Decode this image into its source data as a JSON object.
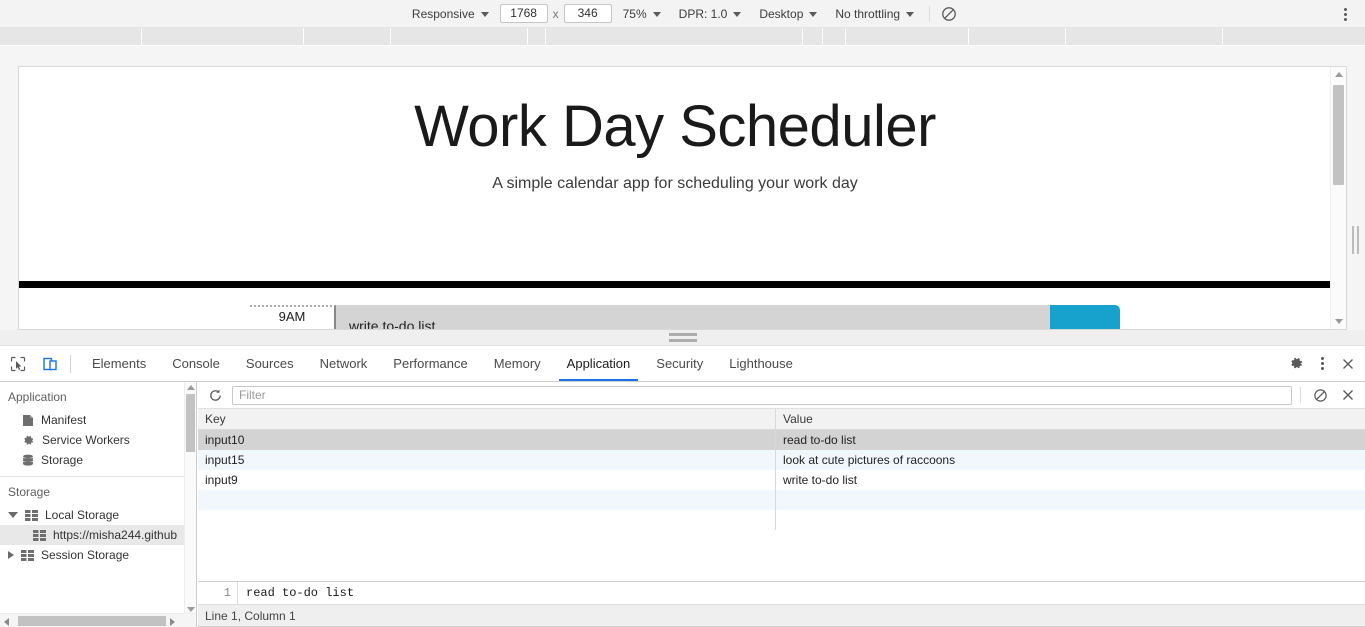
{
  "device_toolbar": {
    "device_select": "Responsive",
    "width": "1768",
    "height": "346",
    "size_separator": "x",
    "zoom": "75%",
    "dpr": "DPR: 1.0",
    "ua_type": "Desktop",
    "throttling": "No throttling",
    "media_icon": "no-media-emulation-icon",
    "more_options_icon": "kebab-menu-icon"
  },
  "page": {
    "title": "Work Day Scheduler",
    "subtitle": "A simple calendar app for scheduling your work day",
    "schedule": {
      "hour": "9AM",
      "task": "write to-do list",
      "save_icon": "calendar-plus-save-icon",
      "accent_color": "#17a2cd",
      "block_color": "#d4d4d4"
    }
  },
  "devtools": {
    "inspect_icon": "inspect-element-icon",
    "device_toolbar_icon": "toggle-device-toolbar-icon",
    "tabs": [
      {
        "label": "Elements",
        "active": false
      },
      {
        "label": "Console",
        "active": false
      },
      {
        "label": "Sources",
        "active": false
      },
      {
        "label": "Network",
        "active": false
      },
      {
        "label": "Performance",
        "active": false
      },
      {
        "label": "Memory",
        "active": false
      },
      {
        "label": "Application",
        "active": true
      },
      {
        "label": "Security",
        "active": false
      },
      {
        "label": "Lighthouse",
        "active": false
      }
    ],
    "active_tab_color": "#1a73e8",
    "settings_icon": "gear-icon",
    "more_icon": "kebab-menu-icon",
    "close_icon": "close-icon"
  },
  "sidebar": {
    "application": {
      "title": "Application",
      "items": [
        {
          "label": "Manifest",
          "icon": "manifest-file-icon"
        },
        {
          "label": "Service Workers",
          "icon": "gear-icon"
        },
        {
          "label": "Storage",
          "icon": "database-icon"
        }
      ]
    },
    "storage": {
      "title": "Storage",
      "items": [
        {
          "label": "Local Storage",
          "icon": "table-icon",
          "expanded": true,
          "selected": false
        },
        {
          "label": "https://misha244.github",
          "icon": "table-icon",
          "child": true,
          "selected": true
        },
        {
          "label": "Session Storage",
          "icon": "table-icon",
          "expanded": false,
          "selected": false
        }
      ]
    }
  },
  "storage_panel": {
    "refresh_icon": "refresh-icon",
    "filter_placeholder": "Filter",
    "filter_value": "",
    "clear_all_icon": "clear-all-icon",
    "delete_selected_icon": "delete-icon",
    "columns": [
      "Key",
      "Value"
    ],
    "rows": [
      {
        "key": "input10",
        "value": "read to-do list",
        "selected": true
      },
      {
        "key": "input15",
        "value": "look at cute pictures of raccoons",
        "selected": false
      },
      {
        "key": "input9",
        "value": "write to-do list",
        "selected": false
      }
    ],
    "preview": {
      "line_number": "1",
      "content": "read to-do list",
      "status": "Line 1, Column 1"
    }
  }
}
